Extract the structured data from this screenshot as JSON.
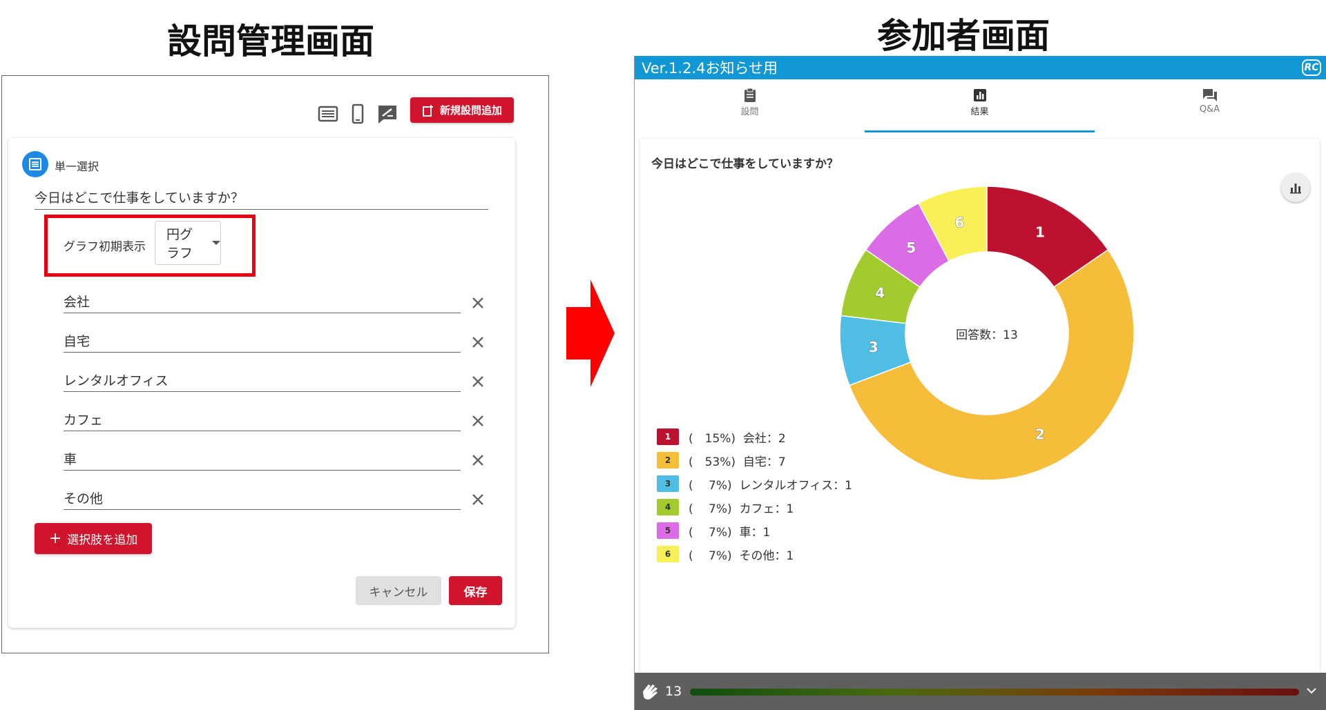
{
  "headings": {
    "admin": "設問管理画面",
    "participant": "参加者画面"
  },
  "admin": {
    "new_question_label": "新規設問追加",
    "question_type": "単一選択",
    "question_text": "今日はどこで仕事をしていますか？",
    "graph_label": "グラフ初期表示",
    "graph_value": "円グラフ",
    "options": [
      "会社",
      "自宅",
      "レンタルオフィス",
      "カフェ",
      "車",
      "その他"
    ],
    "add_option_label": "選択肢を追加",
    "cancel_label": "キャンセル",
    "save_label": "保存"
  },
  "participant": {
    "header_title": "Ver.1.2.4お知らせ用",
    "logo_text": "RC",
    "tabs": [
      "設問",
      "結果",
      "Q&A"
    ],
    "active_tab": "結果",
    "question_text": "今日はどこで仕事をしていますか？",
    "clap_count": "13"
  },
  "chart_data": {
    "type": "pie",
    "donut": true,
    "center_text": "回答数：13",
    "slice_labels": [
      "1",
      "2",
      "3",
      "4",
      "5",
      "6"
    ],
    "categories": [
      "会社",
      "自宅",
      "レンタルオフィス",
      "カフェ",
      "車",
      "その他"
    ],
    "values": [
      2,
      7,
      1,
      1,
      1,
      1
    ],
    "colors": [
      "#bc1230",
      "#f5bd3a",
      "#4fbde4",
      "#a2cb2e",
      "#dc6ce6",
      "#f9f058"
    ],
    "legend_entries": [
      "(　15%)  会社：2",
      "(　53%)  自宅：7",
      "(　 7%)  レンタルオフィス：1",
      "(　 7%)  カフェ：1",
      "(　 7%)  車：1",
      "(　 7%)  その他：1"
    ],
    "legend_placement": "bottom-left"
  }
}
